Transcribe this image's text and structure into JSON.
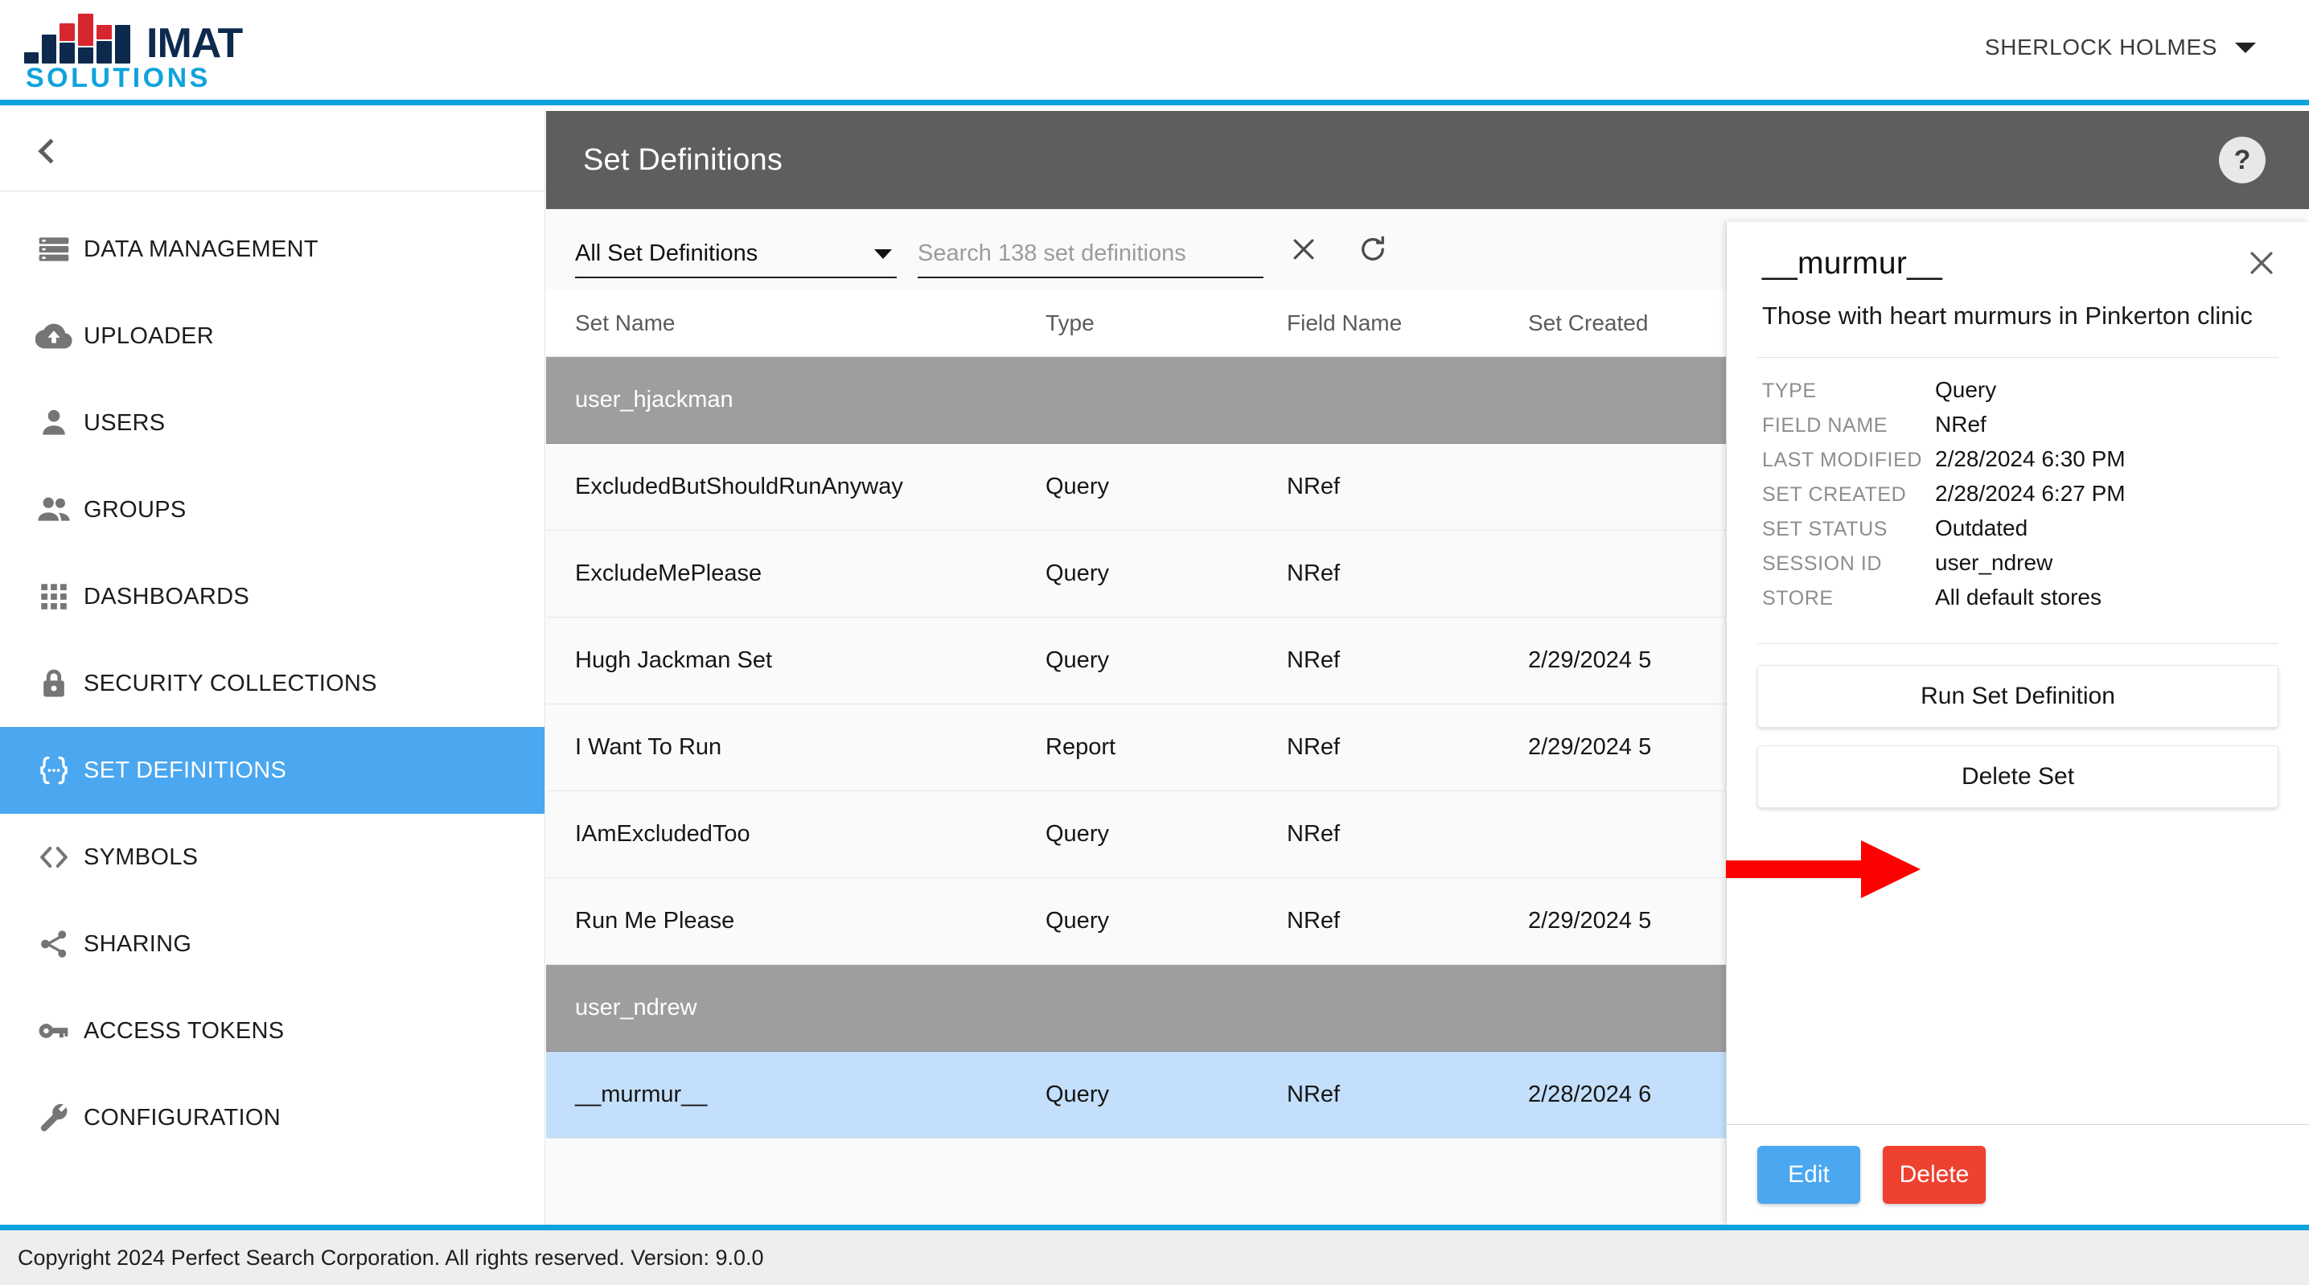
{
  "brand": {
    "name_primary": "IMAT",
    "name_secondary": "SOLUTIONS",
    "accent_blue": "#0fa3dc",
    "navy": "#0d2a4e",
    "red": "#d8262f"
  },
  "topbar": {
    "user_name": "SHERLOCK HOLMES",
    "caret_icon": "chevron-down-icon"
  },
  "sidebar": {
    "collapse_icon": "chevron-left-icon",
    "items": [
      {
        "label": "DATA MANAGEMENT",
        "icon": "storage-icon",
        "active": false
      },
      {
        "label": "UPLOADER",
        "icon": "cloud-upload-icon",
        "active": false
      },
      {
        "label": "USERS",
        "icon": "person-icon",
        "active": false
      },
      {
        "label": "GROUPS",
        "icon": "people-icon",
        "active": false
      },
      {
        "label": "DASHBOARDS",
        "icon": "apps-grid-icon",
        "active": false
      },
      {
        "label": "SECURITY COLLECTIONS",
        "icon": "lock-icon",
        "active": false
      },
      {
        "label": "SET DEFINITIONS",
        "icon": "braces-icon",
        "active": true
      },
      {
        "label": "SYMBOLS",
        "icon": "code-brackets-icon",
        "active": false
      },
      {
        "label": "SHARING",
        "icon": "share-icon",
        "active": false
      },
      {
        "label": "ACCESS TOKENS",
        "icon": "key-icon",
        "active": false
      },
      {
        "label": "CONFIGURATION",
        "icon": "wrench-icon",
        "active": false
      }
    ]
  },
  "page": {
    "title": "Set Definitions",
    "help_icon": "help-icon",
    "help_label": "?"
  },
  "toolbar": {
    "filter_value": "All Set Definitions",
    "filter_icon": "chevron-down-icon",
    "search_value": "",
    "search_placeholder": "Search 138 set definitions",
    "clear_icon": "close-icon",
    "refresh_icon": "refresh-icon"
  },
  "table": {
    "columns": [
      "Set Name",
      "Type",
      "Field Name",
      "Set Created"
    ],
    "rows": [
      {
        "kind": "group",
        "name": "user_hjackman",
        "type": "",
        "field": "",
        "created": ""
      },
      {
        "kind": "data",
        "name": "ExcludedButShouldRunAnyway",
        "type": "Query",
        "field": "NRef",
        "created": ""
      },
      {
        "kind": "data",
        "name": "ExcludeMePlease",
        "type": "Query",
        "field": "NRef",
        "created": ""
      },
      {
        "kind": "data",
        "name": "Hugh Jackman Set",
        "type": "Query",
        "field": "NRef",
        "created": "2/29/2024 5"
      },
      {
        "kind": "data",
        "name": "I Want To Run",
        "type": "Report",
        "field": "NRef",
        "created": "2/29/2024 5"
      },
      {
        "kind": "data",
        "name": "IAmExcludedToo",
        "type": "Query",
        "field": "NRef",
        "created": ""
      },
      {
        "kind": "data",
        "name": "Run Me Please",
        "type": "Query",
        "field": "NRef",
        "created": "2/29/2024 5"
      },
      {
        "kind": "group",
        "name": "user_ndrew",
        "type": "",
        "field": "",
        "created": ""
      },
      {
        "kind": "selected",
        "name": "__murmur__",
        "type": "Query",
        "field": "NRef",
        "created": "2/28/2024 6"
      }
    ]
  },
  "detail": {
    "title": "__murmur__",
    "close_icon": "close-icon",
    "description": "Those with heart murmurs in Pinkerton clinic",
    "meta": [
      {
        "key": "TYPE",
        "value": "Query"
      },
      {
        "key": "FIELD NAME",
        "value": "NRef"
      },
      {
        "key": "LAST MODIFIED",
        "value": "2/28/2024 6:30 PM"
      },
      {
        "key": "SET CREATED",
        "value": "2/28/2024 6:27 PM"
      },
      {
        "key": "SET STATUS",
        "value": "Outdated"
      },
      {
        "key": "SESSION ID",
        "value": "user_ndrew"
      },
      {
        "key": "STORE",
        "value": "All default stores"
      }
    ],
    "actions": [
      {
        "label": "Run Set Definition",
        "name": "run-set-definition-button"
      },
      {
        "label": "Delete Set",
        "name": "delete-set-button"
      }
    ],
    "edit_label": "Edit",
    "delete_label": "Delete",
    "edit_color": "#4aa7f0",
    "delete_color": "#ef4130"
  },
  "annotation": {
    "arrow_icon": "red-arrow-right-icon",
    "arrow_color": "#fd0000",
    "points_to": "Run Set Definition"
  },
  "footer": {
    "text": "Copyright 2024 Perfect Search Corporation. All rights reserved. Version: 9.0.0"
  }
}
